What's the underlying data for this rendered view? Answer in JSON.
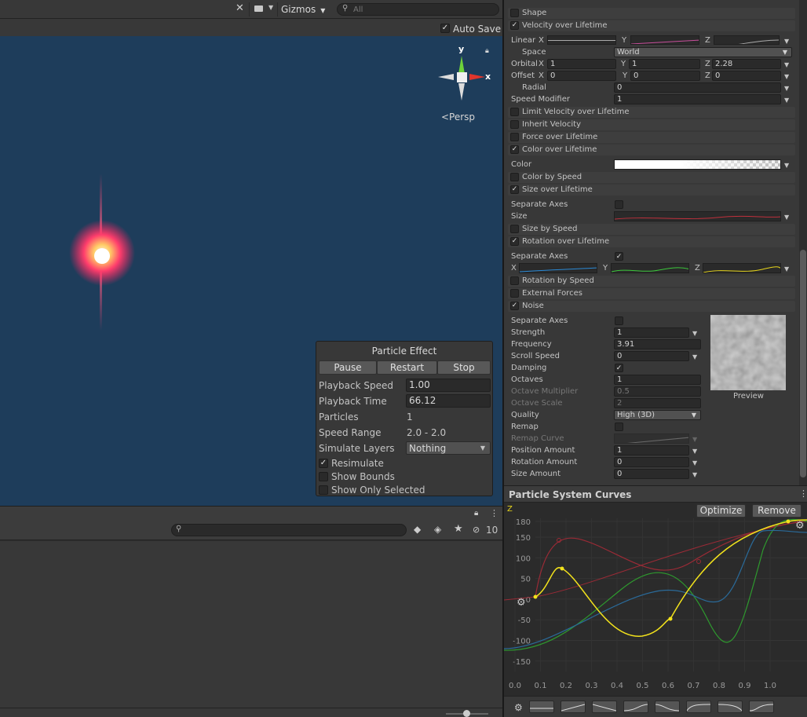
{
  "scene": {
    "gizmos_label": "Gizmos",
    "search_placeholder": "All",
    "auto_save_label": "Auto Save",
    "auto_save_checked": "✓",
    "axis_x": "x",
    "axis_y": "y",
    "persp_label": "<Persp"
  },
  "particle_effect": {
    "title": "Particle Effect",
    "pause": "Pause",
    "restart": "Restart",
    "stop": "Stop",
    "playback_speed_label": "Playback Speed",
    "playback_speed": "1.00",
    "playback_time_label": "Playback Time",
    "playback_time": "66.12",
    "particles_label": "Particles",
    "particles": "1",
    "speed_range_label": "Speed Range",
    "speed_range": "2.0 - 2.0",
    "simulate_layers_label": "Simulate Layers",
    "simulate_layers": "Nothing",
    "resimulate_label": "Resimulate",
    "show_bounds_label": "Show Bounds",
    "show_only_selected_label": "Show Only Selected",
    "check": "✓"
  },
  "hierarchy": {
    "visible_count": "10"
  },
  "inspector": {
    "modules": {
      "shape": "Shape",
      "velocity": "Velocity over Lifetime",
      "limit_velocity": "Limit Velocity over Lifetime",
      "inherit_velocity": "Inherit Velocity",
      "force": "Force over Lifetime",
      "color_lifetime": "Color over Lifetime",
      "color_speed": "Color by Speed",
      "size_lifetime": "Size over Lifetime",
      "size_speed": "Size by Speed",
      "rotation_lifetime": "Rotation over Lifetime",
      "rotation_speed": "Rotation by Speed",
      "external_forces": "External Forces",
      "noise": "Noise",
      "check": "✓"
    },
    "velocity": {
      "linear": "Linear",
      "x": "X",
      "y": "Y",
      "z": "Z",
      "space_label": "Space",
      "space": "World",
      "orbital_label": "Orbital",
      "orbital_x": "1",
      "orbital_y": "1",
      "orbital_z": "2.28",
      "offset_label": "Offset",
      "offset_x": "0",
      "offset_y": "0",
      "offset_z": "0",
      "radial_label": "Radial",
      "radial": "0",
      "speed_modifier_label": "Speed Modifier",
      "speed_modifier": "1"
    },
    "color": {
      "label": "Color"
    },
    "size": {
      "separate_axes_label": "Separate Axes",
      "size_label": "Size"
    },
    "rotation": {
      "separate_axes_label": "Separate Axes",
      "check": "✓",
      "x": "X",
      "y": "Y",
      "z": "Z"
    },
    "noise": {
      "separate_axes": "Separate Axes",
      "strength_label": "Strength",
      "strength": "1",
      "frequency_label": "Frequency",
      "frequency": "3.91",
      "scroll_speed_label": "Scroll Speed",
      "scroll_speed": "0",
      "damping_label": "Damping",
      "damping_check": "✓",
      "octaves_label": "Octaves",
      "octaves": "1",
      "octave_multiplier_label": "Octave Multiplier",
      "octave_multiplier": "0.5",
      "octave_scale_label": "Octave Scale",
      "octave_scale": "2",
      "quality_label": "Quality",
      "quality": "High (3D)",
      "remap_label": "Remap",
      "remap_curve_label": "Remap Curve",
      "position_amount_label": "Position Amount",
      "position_amount": "1",
      "rotation_amount_label": "Rotation Amount",
      "rotation_amount": "0",
      "size_amount_label": "Size Amount",
      "size_amount": "0",
      "preview_label": "Preview"
    }
  },
  "curves": {
    "title": "Particle System Curves",
    "optimize": "Optimize",
    "remove": "Remove",
    "axis_label": "Z",
    "y_ticks": [
      "180",
      "150",
      "100",
      "50",
      "0",
      "-50",
      "-100",
      "-150"
    ],
    "x_ticks": [
      "0.0",
      "0.1",
      "0.2",
      "0.3",
      "0.4",
      "0.5",
      "0.6",
      "0.7",
      "0.8",
      "0.9",
      "1.0"
    ]
  },
  "colors": {
    "scene_bg": "#1e3d5b",
    "panel": "#383838",
    "accent": "#4d8fd6",
    "curve_red": "#9a2b36",
    "curve_yellow": "#f2e21c",
    "curve_green": "#2e9a2e",
    "curve_blue": "#2a6a99"
  }
}
